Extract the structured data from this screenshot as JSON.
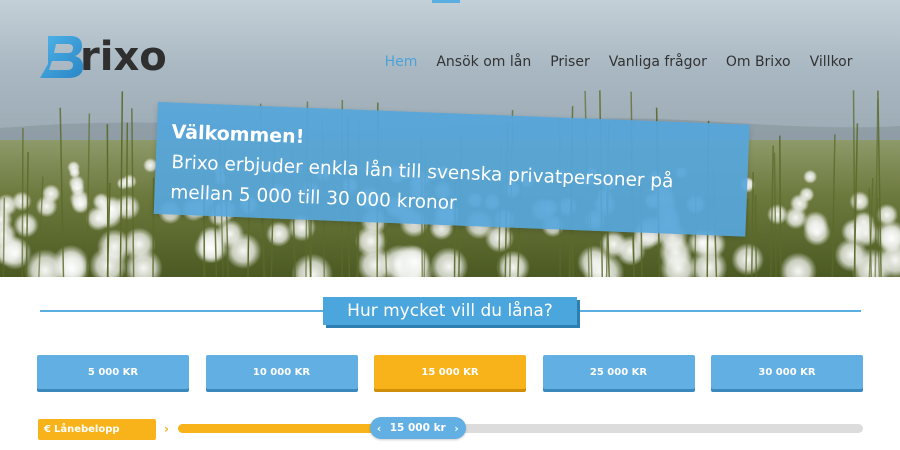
{
  "brand": {
    "name": "rixo",
    "initial": "B",
    "color": "#2f2f2f",
    "accent": "#3ea0da"
  },
  "nav": {
    "items": [
      {
        "label": "Hem",
        "active": true
      },
      {
        "label": "Ansök om lån",
        "active": false
      },
      {
        "label": "Priser",
        "active": false
      },
      {
        "label": "Vanliga frågor",
        "active": false
      },
      {
        "label": "Om Brixo",
        "active": false
      },
      {
        "label": "Villkor",
        "active": false
      }
    ]
  },
  "hero": {
    "title": "Välkommen!",
    "text": "Brixo erbjuder enkla lån till svenska privatpersoner på mellan 5 000 till 30 000 kronor"
  },
  "section": {
    "heading": "Hur mycket vill du låna?"
  },
  "amounts": {
    "options": [
      "5 000 KR",
      "10 000 KR",
      "15 000 KR",
      "25 000 KR",
      "30 000 KR"
    ],
    "selected_index": 2
  },
  "loan": {
    "label": "Lånebelopp",
    "label_icon": "euro-icon",
    "value_text": "15 000 kr",
    "progress": 0.35
  },
  "colors": {
    "primary_blue": "#62afe3",
    "heading_blue": "#4aa6dd",
    "accent_yellow": "#f7b319",
    "track_gray": "#dcdcdc"
  }
}
